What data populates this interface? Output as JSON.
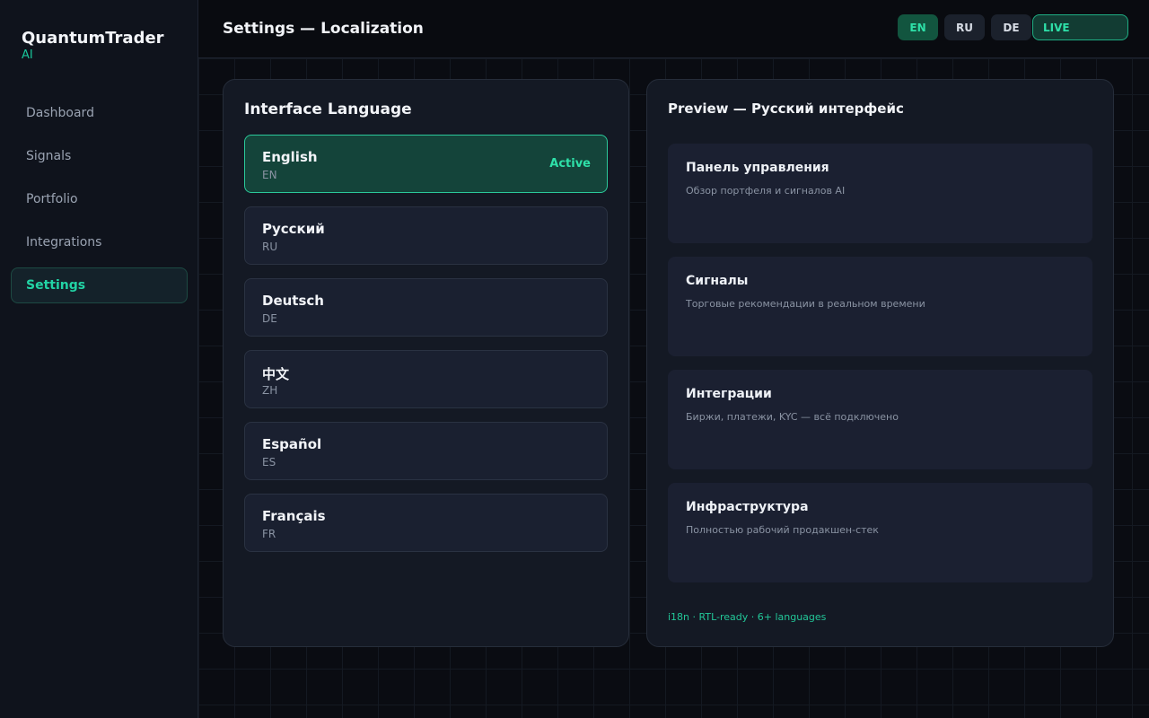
{
  "brand": {
    "name": "QuantumTrader",
    "sub": "AI"
  },
  "sidebar": {
    "items": [
      {
        "label": "Dashboard"
      },
      {
        "label": "Signals"
      },
      {
        "label": "Portfolio"
      },
      {
        "label": "Integrations"
      },
      {
        "label": "Settings",
        "active": true
      }
    ]
  },
  "header": {
    "title": "Settings — Localization",
    "lang_switch": [
      "EN",
      "RU",
      "DE"
    ],
    "active_lang": "EN",
    "live_label": "LIVE"
  },
  "language_card": {
    "title": "Interface Language",
    "options": [
      {
        "name": "English",
        "code": "EN",
        "status": "Active"
      },
      {
        "name": "Русский",
        "code": "RU"
      },
      {
        "name": "Deutsch",
        "code": "DE"
      },
      {
        "name": "中文",
        "code": "ZH"
      },
      {
        "name": "Español",
        "code": "ES"
      },
      {
        "name": "Français",
        "code": "FR"
      }
    ]
  },
  "preview_card": {
    "title": "Preview — Русский интерфейс",
    "items": [
      {
        "title": "Панель управления",
        "desc": "Обзор портфеля и сигналов AI"
      },
      {
        "title": "Сигналы",
        "desc": "Торговые рекомендации в реальном времени"
      },
      {
        "title": "Интеграции",
        "desc": "Биржи, платежи, KYC — всё подключено"
      },
      {
        "title": "Инфраструктура",
        "desc": "Полностью рабочий продакшен-стек"
      }
    ],
    "footer": "i18n · RTL-ready · 6+ languages"
  },
  "colors": {
    "accent": "#22d3a5",
    "background": "#090b10",
    "sidebar": "#0f131c",
    "card": "#141924"
  }
}
